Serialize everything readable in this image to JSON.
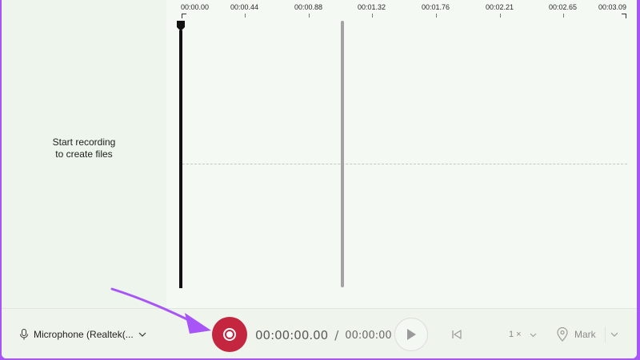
{
  "left_pane": {
    "message_line1": "Start recording",
    "message_line2": "to create files"
  },
  "timeline": {
    "ticks": [
      "00:00.00",
      "00:00.44",
      "00:00.88",
      "00:01.32",
      "00:01.76",
      "00:02.21",
      "00:02.65",
      "00:03.09"
    ]
  },
  "bottom_bar": {
    "microphone_label": "Microphone (Realtek(...",
    "time_current": "00:00:00.00",
    "time_separator": "/",
    "time_total": "00:00:00",
    "speed_label": "1 ×",
    "mark_label": "Mark"
  },
  "colors": {
    "record": "#c4263f",
    "annotation_arrow": "#a855f7",
    "border": "#a855f7"
  },
  "icons": {
    "microphone": "microphone-icon",
    "record": "record-icon",
    "play": "play-icon",
    "skip_back": "skip-back-icon",
    "mark": "location-pin-icon"
  }
}
